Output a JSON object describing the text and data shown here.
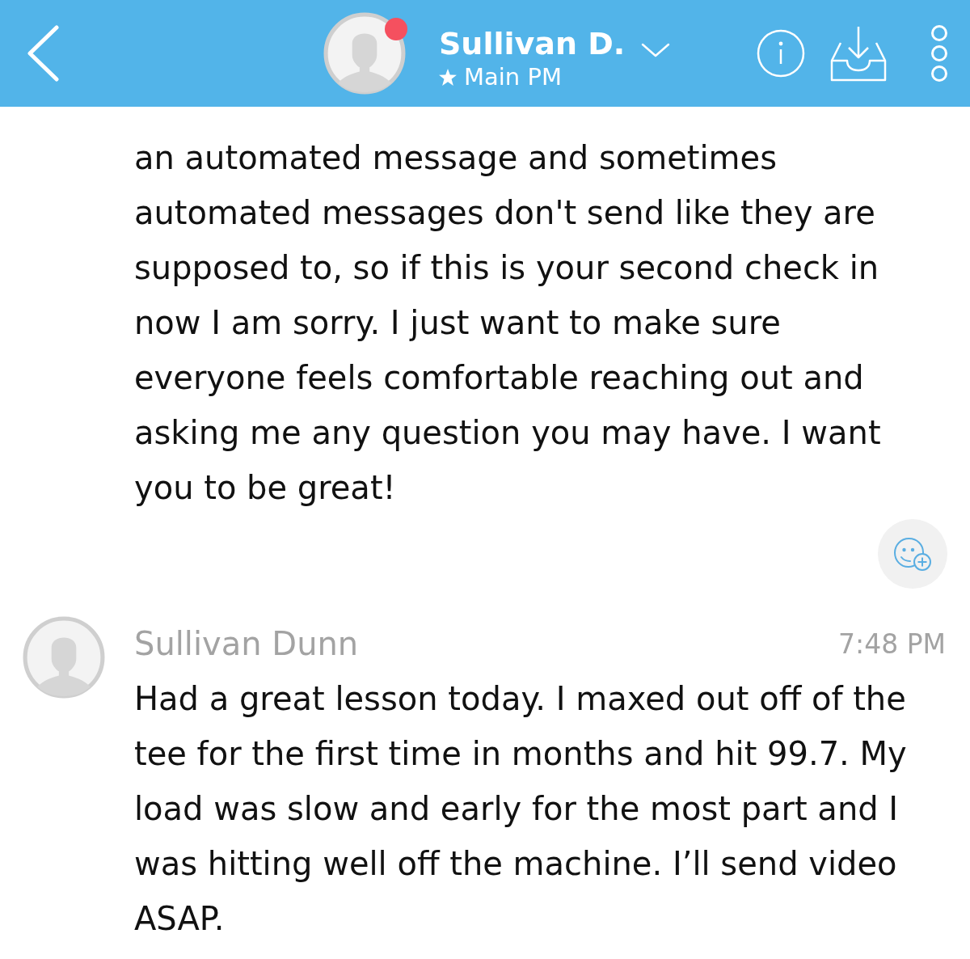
{
  "header": {
    "title": "Sullivan D.",
    "subtitle": "Main PM"
  },
  "messages": [
    {
      "kind": "continuation",
      "text": "an automated message and sometimes automated messages don't send like they are supposed to, so if this is your second check in now I am sorry. I just want to make sure everyone feels comfortable reaching out and asking me any question you may have. I want you to be great!",
      "reaction_button": true
    },
    {
      "kind": "full",
      "sender": "Sullivan Dunn",
      "time": "7:48 PM",
      "text": "Had a great lesson today. I maxed out off of the tee for the first time in months and hit 99.7. My load was slow and early for the most part and I was hitting well off the machine. I’ll send video ASAP.",
      "reaction_button": false
    }
  ]
}
